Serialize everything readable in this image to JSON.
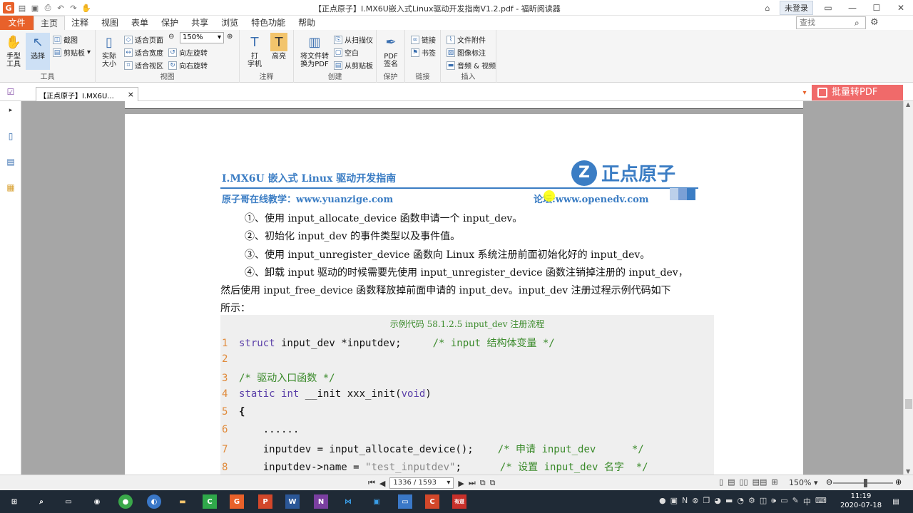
{
  "app": {
    "window_title": "【正点原子】I.MX6U嵌入式Linux驱动开发指南V1.2.pdf - 福昕阅读器",
    "login_label": "未登录",
    "search_placeholder": "查找",
    "logo_letter": "G"
  },
  "menu_tabs": [
    "文件",
    "主页",
    "注释",
    "视图",
    "表单",
    "保护",
    "共享",
    "浏览",
    "特色功能",
    "帮助"
  ],
  "ribbon": {
    "tools": {
      "label": "工具",
      "hand": "手型\n工具",
      "select": "选择",
      "snapshot": "截图",
      "clipboard": "剪贴板"
    },
    "view": {
      "label": "视图",
      "actual_size": "实际\n大小",
      "fit_page": "适合页面",
      "fit_width": "适合宽度",
      "fit_visible": "适合视区",
      "zoom": "150%",
      "rotate_left": "向左旋转",
      "rotate_right": "向右旋转"
    },
    "comment": {
      "label": "注释",
      "typewriter": "打\n字机",
      "highlight": "高亮"
    },
    "create": {
      "label": "创建",
      "convert": "将文件转\n换为PDF",
      "from_scanner": "从扫描仪",
      "blank": "空白",
      "from_clipboard": "从剪贴板"
    },
    "protect": {
      "label": "保护",
      "pdf_sign": "PDF\n签名"
    },
    "link": {
      "label": "链接",
      "link": "链接",
      "bookmark": "书签"
    },
    "insert": {
      "label": "插入",
      "attachment": "文件附件",
      "image_annotation": "图像标注",
      "audio_video": "音频 & 视频"
    }
  },
  "doc_tab": {
    "label": "【正点原子】I.MX6U...",
    "close": "×"
  },
  "batch_button": "批量转PDF",
  "document": {
    "header_title": "I.MX6U 嵌入式 Linux 驱动开发指南",
    "brand": "正点原子",
    "brand_mark": "Z",
    "site_left": "原子哥在线教学：www.yuanzige.com",
    "site_right": "论坛:www.openedv.com",
    "paragraphs": [
      "①、使用 input_allocate_device 函数申请一个 input_dev。",
      "②、初始化 input_dev 的事件类型以及事件值。",
      "③、使用 input_unregister_device 函数向 Linux 系统注册前面初始化好的 input_dev。",
      "④、卸载 input 驱动的时候需要先使用 input_unregister_device 函数注销掉注册的 input_dev，",
      "然后使用 input_free_device 函数释放掉前面申请的 input_dev。input_dev 注册过程示例代码如下",
      "所示："
    ],
    "code_title": "示例代码 58.1.2.5 input_dev 注册流程",
    "code": {
      "l1": {
        "n": "1",
        "kw": "struct",
        "rest": " input_dev *inputdev;",
        "cm": "/* input 结构体变量 */"
      },
      "l2": {
        "n": "2"
      },
      "l3": {
        "n": "3",
        "cm": "/* 驱动入口函数 */"
      },
      "l4": {
        "n": "4",
        "kw1": "static",
        "kw2": "int",
        "mid": " __init xxx_init(",
        "kw3": "void",
        "end": ")"
      },
      "l5": {
        "n": "5",
        "text": "{"
      },
      "l6": {
        "n": "6",
        "text": "    ......"
      },
      "l7": {
        "n": "7",
        "text": "    inputdev = input_allocate_device();",
        "cm": "/* 申请 input_dev      */"
      },
      "l8": {
        "n": "8",
        "a": "    inputdev->name = ",
        "str": "\"test_inputdev\"",
        "b": ";",
        "cm": "/* 设置 input_dev 名字  */"
      }
    }
  },
  "status_bar": {
    "page": "1336 / 1593",
    "zoom": "150%"
  },
  "taskbar": {
    "time": "11:19",
    "date": "2020-07-18",
    "ime": "中"
  }
}
